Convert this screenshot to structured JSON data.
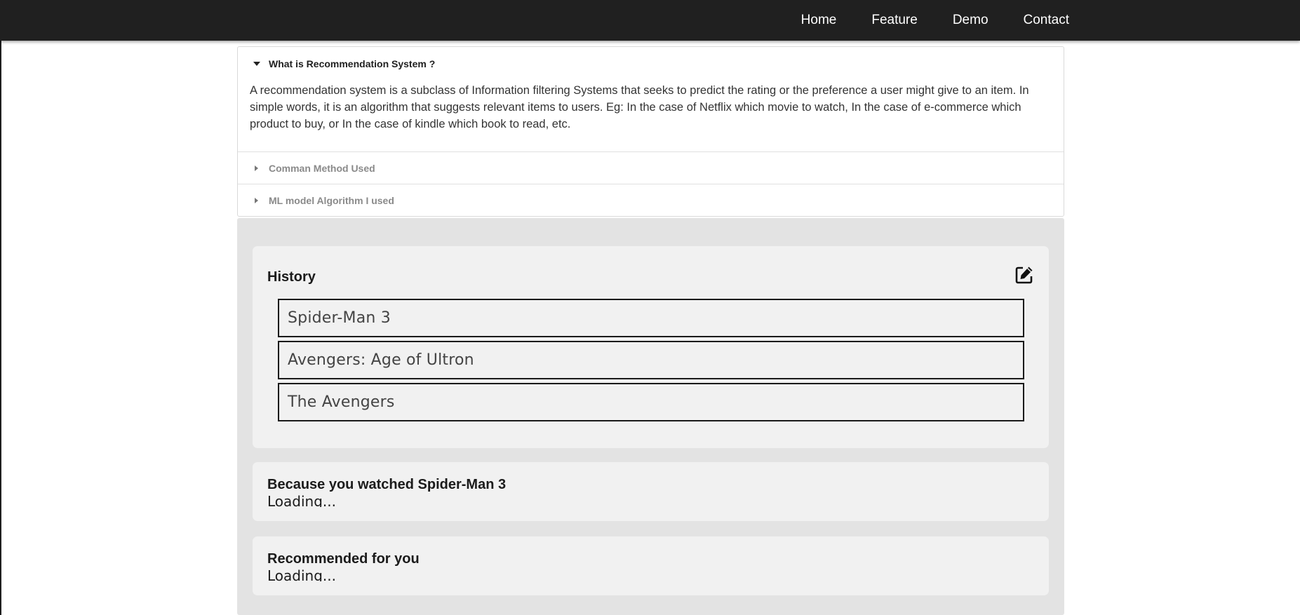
{
  "nav": {
    "links": [
      "Home",
      "Feature",
      "Demo",
      "Contact"
    ]
  },
  "accordion": {
    "items": [
      {
        "title": "What is Recommendation System ?",
        "expanded": true,
        "body": "A recommendation system is a subclass of Information filtering Systems that seeks to predict the rating or the preference a user might give to an item. In simple words, it is an algorithm that suggests relevant items to users. Eg: In the case of Netflix which movie to watch, In the case of e-commerce which product to buy, or In the case of kindle which book to read, etc."
      },
      {
        "title": "Comman Method Used",
        "expanded": false
      },
      {
        "title": "ML model Algorithm I used",
        "expanded": false
      }
    ]
  },
  "history": {
    "title": "History",
    "edit_icon": "edit-icon",
    "items": [
      "Spider-Man 3",
      "Avengers: Age of Ultron",
      "The Avengers"
    ]
  },
  "recommendations": [
    {
      "title": "Because you watched Spider-Man 3",
      "status": "Loading..."
    },
    {
      "title": "Recommended for you",
      "status": "Loading..."
    }
  ],
  "colors": {
    "navbar": "#202020",
    "panel": "#e3e3e3",
    "card": "#f1f1f1"
  }
}
